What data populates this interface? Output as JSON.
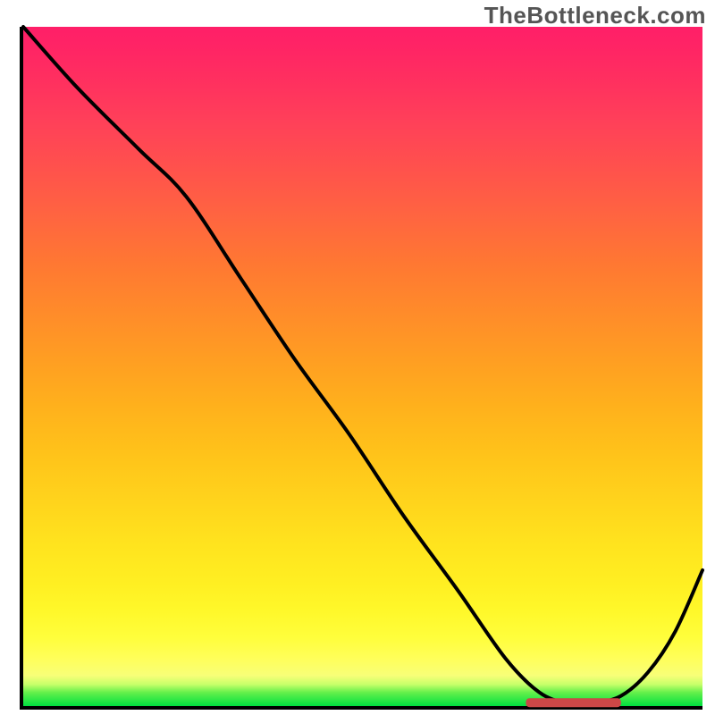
{
  "watermark": "TheBottleneck.com",
  "colors": {
    "gradient_top": "#ff1f68",
    "gradient_mid": "#ffe31e",
    "gradient_bottom": "#00e040",
    "curve": "#000000",
    "marker": "#cc4747",
    "axes": "#000000"
  },
  "chart_data": {
    "type": "line",
    "title": "",
    "xlabel": "",
    "ylabel": "",
    "xlim": [
      0,
      100
    ],
    "ylim": [
      0,
      100
    ],
    "x": [
      0,
      8,
      17,
      24,
      32,
      40,
      48,
      56,
      64,
      71,
      76,
      80,
      84,
      88,
      92,
      96,
      100
    ],
    "values": [
      100,
      91,
      82,
      75,
      63,
      51,
      40,
      28,
      17,
      7,
      2,
      0.5,
      0.5,
      1.5,
      5,
      11,
      20
    ],
    "marker_band": {
      "x_start": 74,
      "x_end": 88,
      "y": 0.5
    },
    "annotations": []
  }
}
